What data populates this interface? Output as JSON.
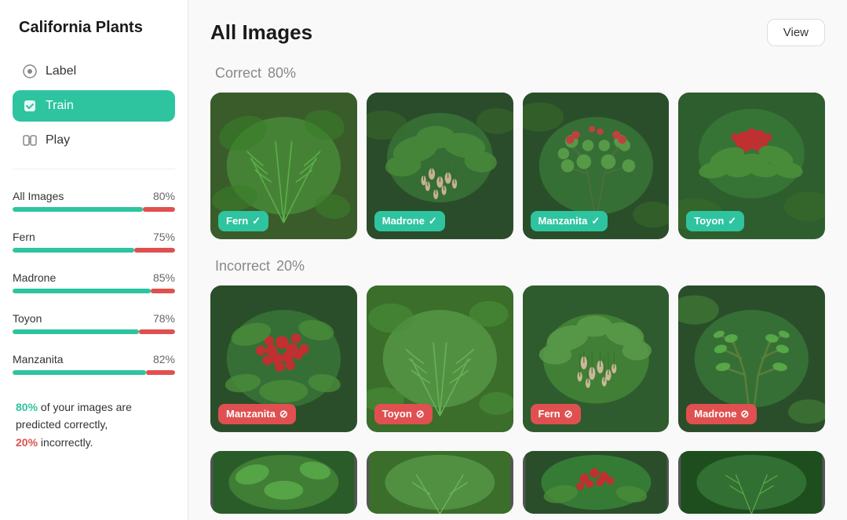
{
  "app": {
    "title": "California Plants"
  },
  "sidebar": {
    "nav": [
      {
        "id": "label",
        "label": "Label",
        "icon": "label-icon",
        "active": false
      },
      {
        "id": "train",
        "label": "Train",
        "icon": "train-icon",
        "active": true
      },
      {
        "id": "play",
        "label": "Play",
        "icon": "play-icon",
        "active": false
      }
    ],
    "stats": [
      {
        "id": "all",
        "label": "All Images",
        "pct": 80,
        "red_pct": 20
      },
      {
        "id": "fern",
        "label": "Fern",
        "pct": 75,
        "red_pct": 25
      },
      {
        "id": "madrone",
        "label": "Madrone",
        "pct": 85,
        "red_pct": 15
      },
      {
        "id": "toyon",
        "label": "Toyon",
        "pct": 78,
        "red_pct": 22
      },
      {
        "id": "manzanita",
        "label": "Manzanita",
        "pct": 82,
        "red_pct": 18
      }
    ],
    "summary": {
      "correct_pct": "80%",
      "incorrect_pct": "20%",
      "text1": "of your images are",
      "text2": "predicted correctly,",
      "text3": "incorrectly."
    }
  },
  "main": {
    "title": "All Images",
    "view_button": "View",
    "correct_section": {
      "label": "Correct",
      "pct": "80%"
    },
    "incorrect_section": {
      "label": "Incorrect",
      "pct": "20%"
    },
    "correct_images": [
      {
        "plant": "Fern",
        "correct": true,
        "color1": "#3a6e3a",
        "color2": "#5a9e4a"
      },
      {
        "plant": "Madrone",
        "correct": true,
        "color1": "#2a5c2a",
        "color2": "#4a8c3a"
      },
      {
        "plant": "Manzanita",
        "correct": true,
        "color1": "#1e4e1e",
        "color2": "#3a7e3a"
      },
      {
        "plant": "Toyon",
        "correct": true,
        "color1": "#2e5e2e",
        "color2": "#4e8e3e"
      }
    ],
    "incorrect_images": [
      {
        "plant": "Manzanita",
        "correct": false,
        "color1": "#2a4e2a",
        "color2": "#4a7e3a"
      },
      {
        "plant": "Toyon",
        "correct": false,
        "color1": "#3a6e2a",
        "color2": "#5a9e4a"
      },
      {
        "plant": "Fern",
        "correct": false,
        "color1": "#2e5e2e",
        "color2": "#4e8e3e"
      },
      {
        "plant": "Madrone",
        "correct": false,
        "color1": "#1e4e1e",
        "color2": "#3a7e3a"
      }
    ],
    "bottom_images": [
      {
        "color1": "#2a5c2a",
        "color2": "#4a8c3a"
      },
      {
        "color1": "#3a6e2a",
        "color2": "#5a9e3a"
      },
      {
        "color1": "#2e5e2e",
        "color2": "#4e8e3e"
      },
      {
        "color1": "#1e4e1e",
        "color2": "#3a7e3a"
      }
    ]
  }
}
